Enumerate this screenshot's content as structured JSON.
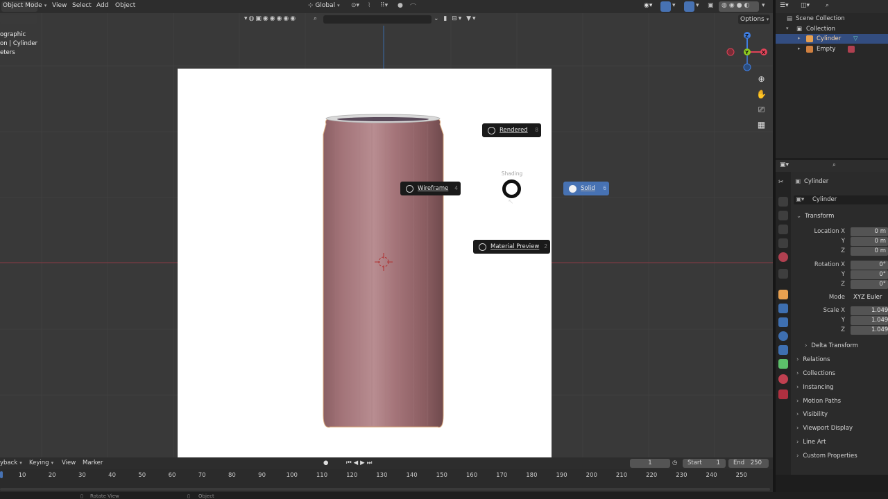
{
  "header": {
    "mode": "Object Mode",
    "menus": [
      "View",
      "Select",
      "Add",
      "Object"
    ],
    "transform_orientation": "Global",
    "options": "Options"
  },
  "overlay": {
    "line1": "ographic",
    "line2": "on | Cylinder",
    "line3": "eters"
  },
  "pie_menu": {
    "title": "Shading",
    "rendered": {
      "label": "Rendered",
      "key": "8"
    },
    "wireframe": {
      "label": "Wireframe",
      "key": "4"
    },
    "solid": {
      "label": "Solid",
      "key": "6"
    },
    "material_preview": {
      "label": "Material Preview",
      "key": "2"
    }
  },
  "gizmo": {
    "x": "X",
    "y": "Y",
    "z": "Z"
  },
  "outliner": {
    "scene_collection": "Scene Collection",
    "collection": "Collection",
    "items": [
      {
        "name": "Cylinder",
        "selected": true
      },
      {
        "name": "Empty",
        "selected": false
      }
    ]
  },
  "properties": {
    "object_name": "Cylinder",
    "data_name": "Cylinder",
    "transform": {
      "title": "Transform",
      "location_label": "Location X",
      "rotation_label": "Rotation X",
      "scale_label": "Scale X",
      "y_label": "Y",
      "z_label": "Z",
      "location": [
        "0 m",
        "0 m",
        "0 m"
      ],
      "rotation": [
        "0°",
        "0°",
        "0°"
      ],
      "mode_label": "Mode",
      "mode_value": "XYZ Euler",
      "scale": [
        "1.049",
        "1.049",
        "1.049"
      ],
      "delta": "Delta Transform"
    },
    "sections": [
      "Relations",
      "Collections",
      "Instancing",
      "Motion Paths",
      "Visibility",
      "Viewport Display",
      "Line Art",
      "Custom Properties"
    ]
  },
  "timeline": {
    "menus": [
      "yback",
      "Keying",
      "View",
      "Marker"
    ],
    "current_frame": "1",
    "start_label": "Start",
    "start": "1",
    "end_label": "End",
    "end": "250",
    "ticks": [
      "10",
      "20",
      "30",
      "40",
      "50",
      "60",
      "70",
      "80",
      "90",
      "100",
      "110",
      "120",
      "130",
      "140",
      "150",
      "160",
      "170",
      "180",
      "190",
      "200",
      "210",
      "220",
      "230",
      "240",
      "250"
    ]
  },
  "status": {
    "left": "Rotate View",
    "mid": "Object"
  },
  "colors": {
    "viewport_bg": "#393939",
    "accent_blue": "#4772b3",
    "selected_row": "#334d80",
    "x_axis": "#e04358",
    "y_axis": "#8ecb1f",
    "z_axis": "#3f7ee2"
  }
}
